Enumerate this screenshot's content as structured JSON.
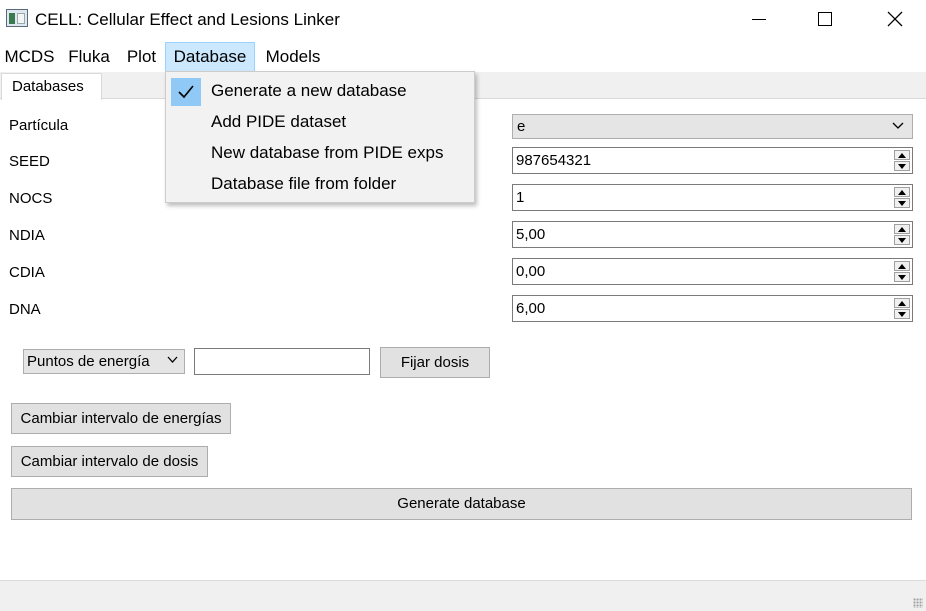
{
  "window": {
    "title": "CELL: Cellular Effect and Lesions Linker",
    "icon": "app-window-icon",
    "controls": {
      "minimize": "minimize-icon",
      "maximize": "maximize-icon",
      "close": "close-icon"
    }
  },
  "menubar": {
    "items": [
      "MCDS",
      "Fluka",
      "Plot",
      "Database",
      "Models"
    ],
    "active": "Database"
  },
  "dropdown": {
    "items": [
      {
        "label": "Generate a new database",
        "checked": true
      },
      {
        "label": "Add PIDE dataset",
        "checked": false
      },
      {
        "label": "New database from PIDE exps",
        "checked": false
      },
      {
        "label": "Database file from folder",
        "checked": false
      }
    ]
  },
  "tabs": [
    "Databases"
  ],
  "form": {
    "particula": {
      "label": "Partícula",
      "value": "e"
    },
    "seed": {
      "label": "SEED",
      "value": "987654321"
    },
    "nocs": {
      "label": "NOCS",
      "value": "1"
    },
    "ndia": {
      "label": "NDIA",
      "value": "5,00"
    },
    "cdia": {
      "label": "CDIA",
      "value": "0,00"
    },
    "dna": {
      "label": "DNA",
      "value": "6,00"
    }
  },
  "dose": {
    "mode_selected": "Puntos de energía",
    "input_value": "",
    "fix_button": "Fijar dosis"
  },
  "buttons": {
    "change_energy": "Cambiar intervalo de energías",
    "change_dose": "Cambiar intervalo de dosis",
    "generate": "Generate database"
  },
  "colors": {
    "menu_active_bg": "#cce8ff",
    "check_bg": "#90c8f6",
    "button_bg": "#e1e1e1"
  }
}
